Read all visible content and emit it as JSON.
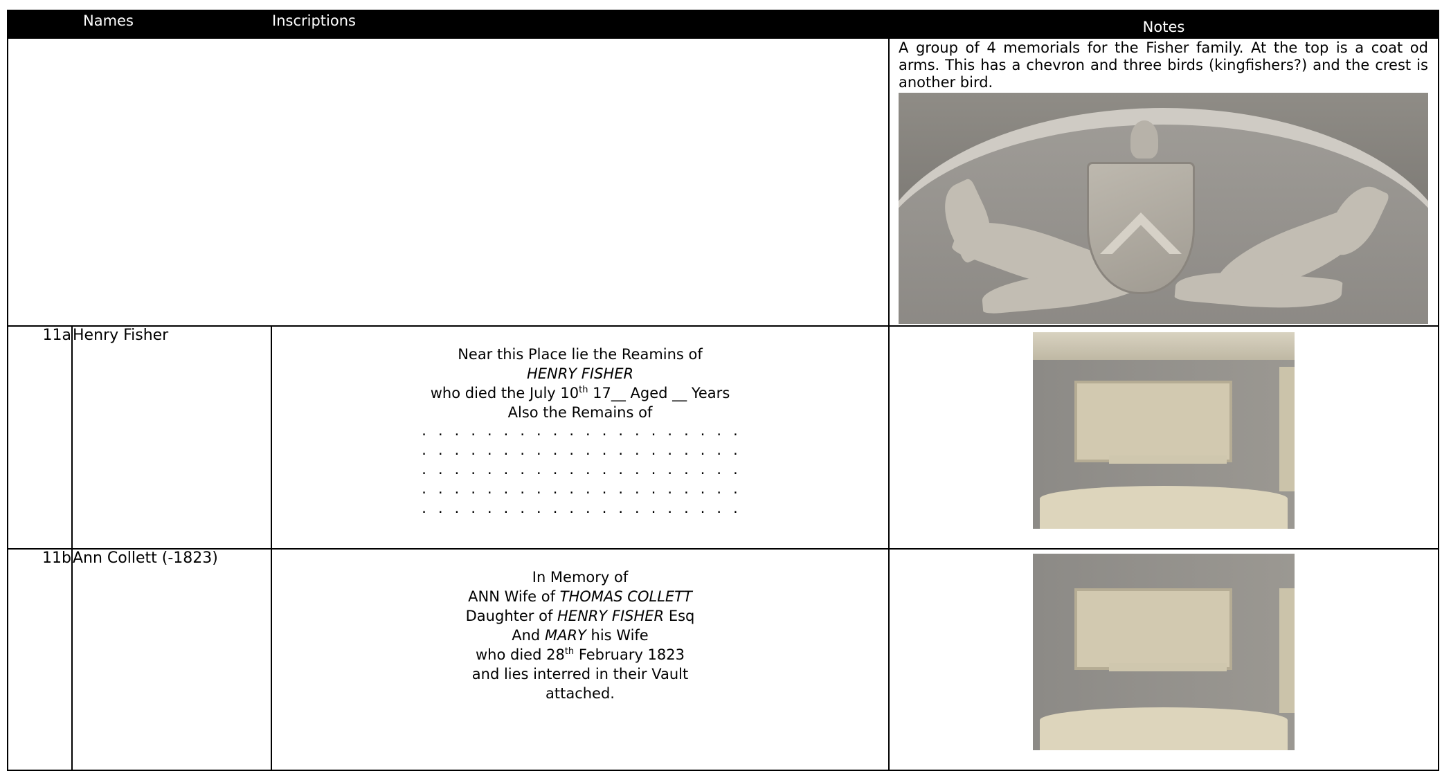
{
  "header": {
    "num": "",
    "names": "Names",
    "inscriptions": "Inscriptions",
    "notes": "Notes"
  },
  "intro_row": {
    "notes": "A group of 4 memorials for the Fisher family. At the top is a coat od arms. This has a chevron and three birds (kingfishers?) and the crest is another bird."
  },
  "rows": [
    {
      "num": "11a",
      "name": "Henry Fisher",
      "inscription": {
        "l1": "Near this Place lie the Reamins of",
        "l2": "HENRY FISHER",
        "l3a": "who died the July 10",
        "l3sup": "th",
        "l3b": " 17__  Aged __ Years",
        "l4": "Also the Remains of",
        "dots": ". . . . . . . . . . . . . . . . . . . ."
      }
    },
    {
      "num": "11b",
      "name": "Ann Collett (-1823)",
      "inscription": {
        "l1": "In Memory of",
        "l2a": "ANN Wife of ",
        "l2b": "THOMAS COLLETT",
        "l3a": "Daughter of ",
        "l3b": "HENRY FISHER",
        "l3c": " Esq",
        "l4a": "And ",
        "l4b": "MARY",
        "l4c": " his Wife",
        "l5a": "who died 28",
        "l5sup": "th",
        "l5b": " February 1823",
        "l6": "and lies interred in their Vault",
        "l7": "attached."
      }
    }
  ]
}
